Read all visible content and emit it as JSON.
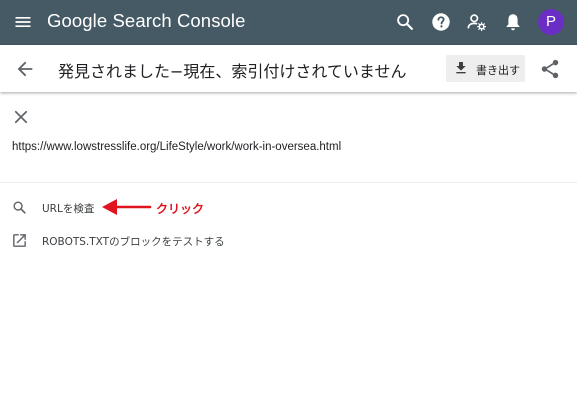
{
  "app": {
    "brand": "Google Search Console",
    "avatar_letter": "P"
  },
  "header": {
    "title": "発見されました−現在、索引付けされていません",
    "export_label": "書き出す"
  },
  "panel": {
    "url": "https://www.lowstresslife.org/LifeStyle/work/work-in-oversea.html",
    "actions": [
      {
        "label": "URLを検査",
        "icon": "search-icon"
      },
      {
        "label": "ROBOTS.TXTのブロックをテストする",
        "icon": "open-in-new-icon"
      }
    ],
    "annotation": "クリック"
  },
  "colors": {
    "topbar": "#455a64",
    "avatar": "#6a2ec4",
    "annotation": "#e0141e"
  }
}
